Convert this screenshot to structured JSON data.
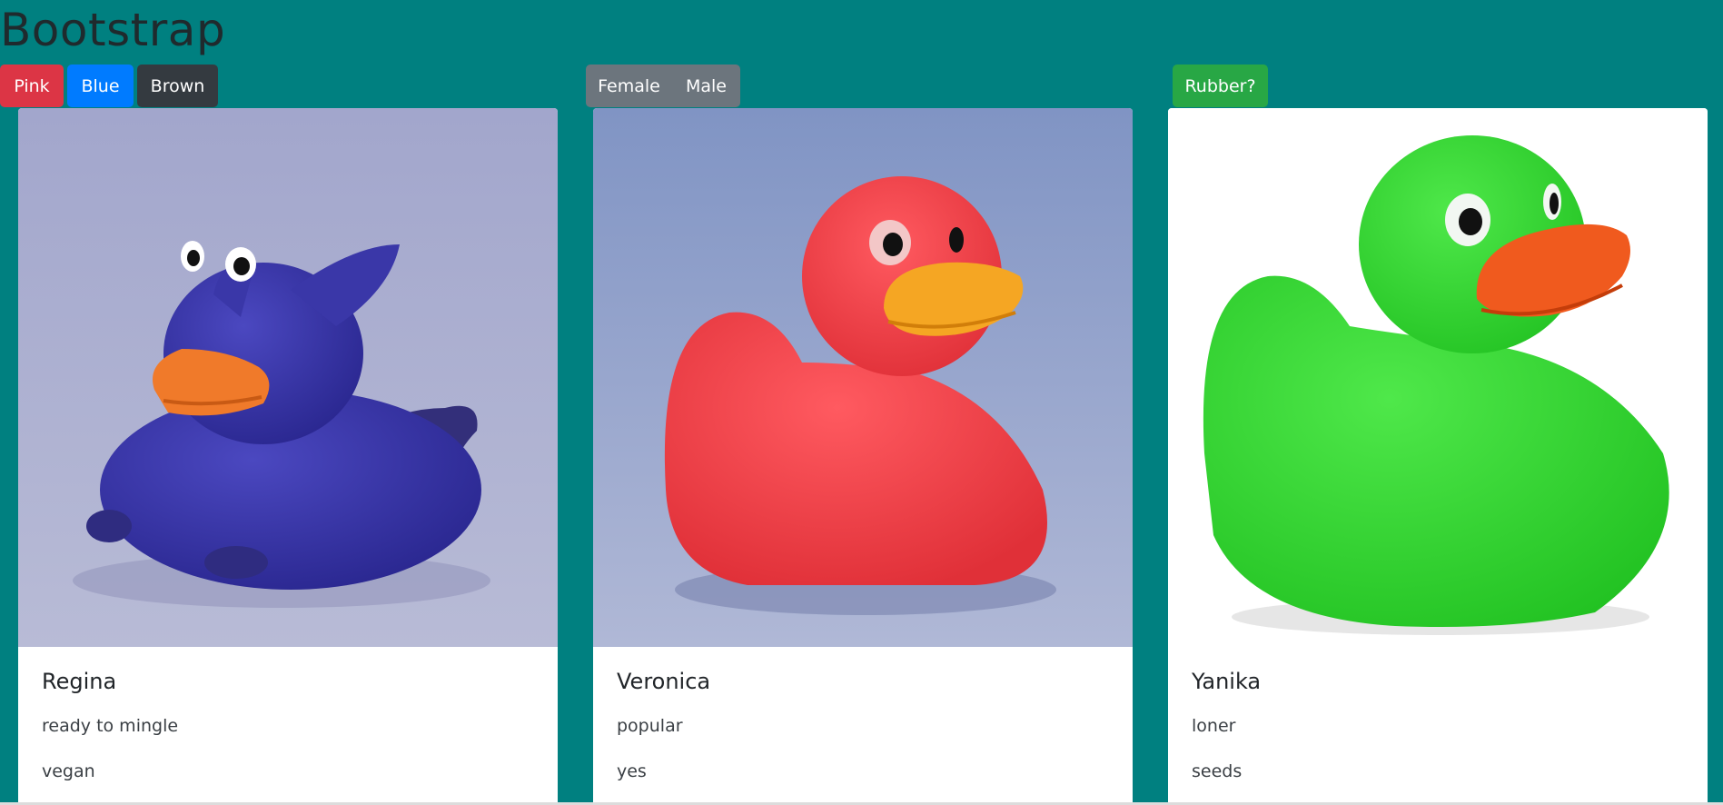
{
  "page": {
    "title": "Bootstrap"
  },
  "color_filters": {
    "pink_label": "Pink",
    "blue_label": "Blue",
    "brown_label": "Brown"
  },
  "gender_filters": {
    "female_label": "Female",
    "male_label": "Male"
  },
  "material_filter": {
    "rubber_label": "Rubber?"
  },
  "cards": [
    {
      "title": "Regina",
      "text1": "ready to mingle",
      "text2": "vegan",
      "image_desc": "blue-bat-rubber-duck"
    },
    {
      "title": "Veronica",
      "text1": "popular",
      "text2": "yes",
      "image_desc": "red-rubber-duck"
    },
    {
      "title": "Yanika",
      "text1": "loner",
      "text2": "seeds",
      "image_desc": "green-rubber-duck"
    }
  ],
  "colors": {
    "background": "#008080",
    "pink": "#dc3545",
    "blue": "#007bff",
    "brown": "#343a40",
    "gray": "#6c757d",
    "green": "#28a745"
  }
}
